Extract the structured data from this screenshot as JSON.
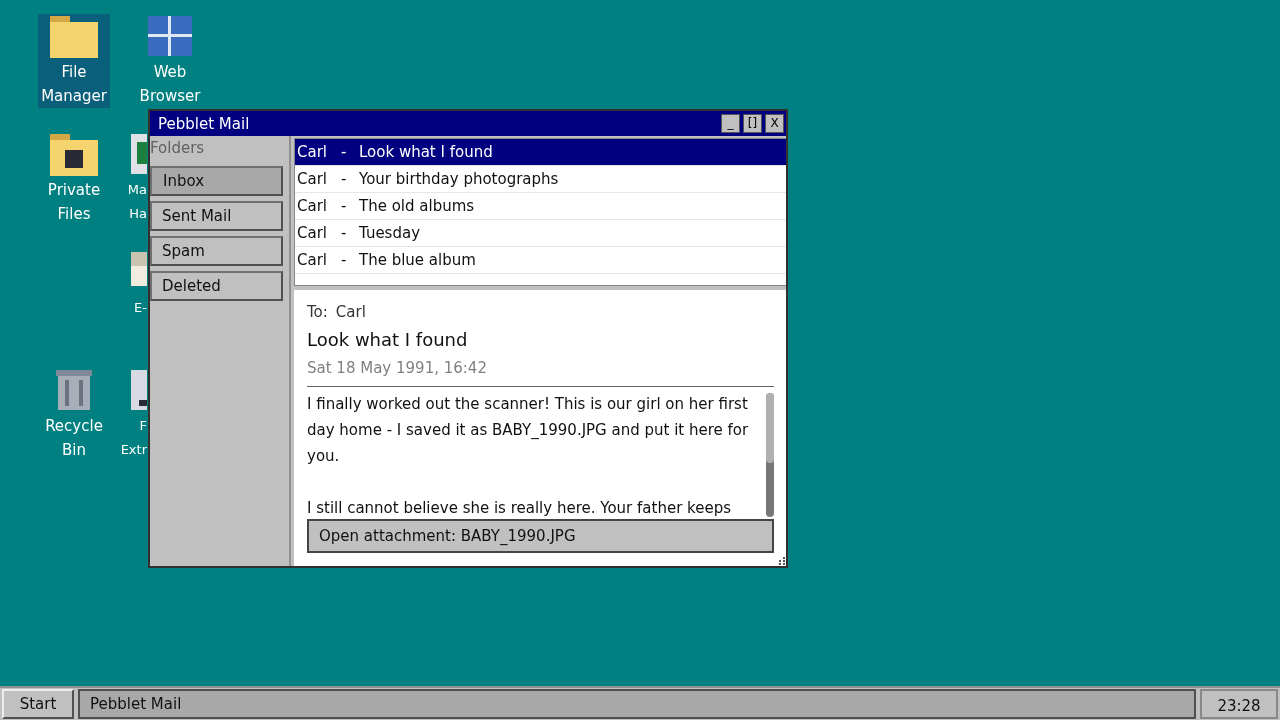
{
  "desktop_icons": [
    {
      "kind": "folder",
      "lines": [
        "File",
        "Manager"
      ],
      "selected": true
    },
    {
      "kind": "browser",
      "lines": [
        "Web",
        "Browser"
      ],
      "selected": false
    },
    {
      "kind": "private-folder",
      "lines": [
        "Private",
        "Files"
      ],
      "selected": false
    },
    {
      "kind": "green-app",
      "lines": [
        "Ma",
        "Ha"
      ],
      "selected": false
    },
    {
      "kind": "document",
      "lines": [
        "E-"
      ],
      "selected": false
    },
    {
      "kind": "trash",
      "lines": [
        "Recycle",
        "Bin"
      ],
      "selected": false
    },
    {
      "kind": "drive",
      "lines": [
        "F",
        "Extr"
      ],
      "selected": false
    }
  ],
  "window": {
    "title": "Pebblet Mail",
    "title_buttons": [
      "_",
      "[]",
      "X"
    ],
    "sidebar": {
      "heading": "Folders",
      "folders": [
        {
          "label": "Inbox",
          "selected": true
        },
        {
          "label": "Sent Mail",
          "selected": false
        },
        {
          "label": "Spam",
          "selected": false
        },
        {
          "label": "Deleted",
          "selected": false
        }
      ]
    },
    "messages": [
      {
        "from": "Carl",
        "separator": "-",
        "subject": "Look what I found",
        "selected": true
      },
      {
        "from": "Carl",
        "separator": "-",
        "subject": "Your birthday photographs",
        "selected": false
      },
      {
        "from": "Carl",
        "separator": "-",
        "subject": "The old albums",
        "selected": false
      },
      {
        "from": "Carl",
        "separator": "-",
        "subject": "Tuesday",
        "selected": false
      },
      {
        "from": "Carl",
        "separator": "-",
        "subject": "The blue album",
        "selected": false
      }
    ],
    "preview": {
      "to_label": "To:",
      "to": "Carl",
      "subject": "Look what I found",
      "date": "Sat 18 May 1991, 16:42",
      "body": [
        "I finally worked out the scanner! This is our girl on her first day home - I saved it as BABY_1990.JPG and put it here for you.",
        "I still cannot believe she is really here. Your father keeps"
      ],
      "attachment_button": "Open attachment: BABY_1990.JPG"
    }
  },
  "taskbar": {
    "start": "Start",
    "tasks": [
      {
        "label": "Pebblet Mail",
        "selected": true
      }
    ],
    "clock": "23:28"
  }
}
